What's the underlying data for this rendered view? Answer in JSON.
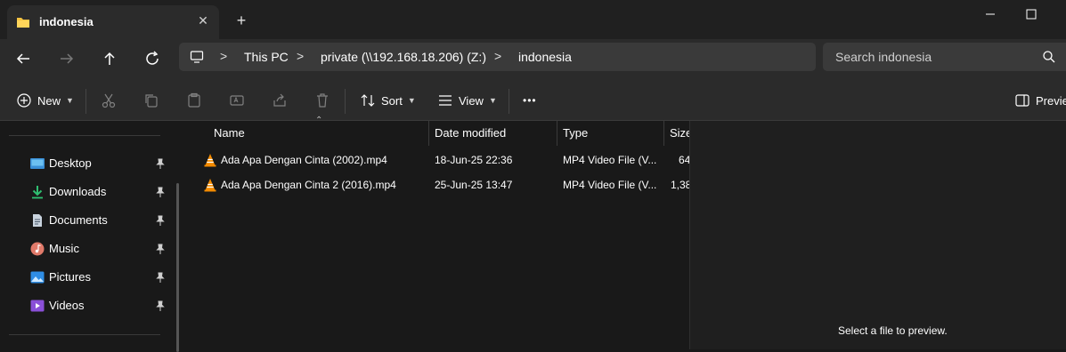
{
  "window": {
    "tab_title": "indonesia",
    "tab_close": "✕",
    "new_tab": "+"
  },
  "address": {
    "crumbs": [
      "This PC",
      "private (\\\\192.168.18.206) (Z:)",
      "indonesia"
    ],
    "separator": ">"
  },
  "search": {
    "placeholder": "Search indonesia"
  },
  "toolbar": {
    "new_label": "New",
    "sort_label": "Sort",
    "view_label": "View",
    "more_label": "•••",
    "preview_label": "Preview"
  },
  "sidebar": {
    "items": [
      {
        "label": "Desktop",
        "icon": "desktop-icon"
      },
      {
        "label": "Downloads",
        "icon": "downloads-icon"
      },
      {
        "label": "Documents",
        "icon": "documents-icon"
      },
      {
        "label": "Music",
        "icon": "music-icon"
      },
      {
        "label": "Pictures",
        "icon": "pictures-icon"
      },
      {
        "label": "Videos",
        "icon": "videos-icon"
      }
    ]
  },
  "files": {
    "columns": [
      "Name",
      "Date modified",
      "Type",
      "Size"
    ],
    "rows": [
      {
        "name": "Ada Apa Dengan Cinta (2002).mp4",
        "date": "18-Jun-25 22:36",
        "type": "MP4 Video File (V...",
        "size": "64"
      },
      {
        "name": "Ada Apa Dengan Cinta 2 (2016).mp4",
        "date": "25-Jun-25 13:47",
        "type": "MP4 Video File (V...",
        "size": "1,38"
      }
    ]
  },
  "preview": {
    "message": "Select a file to preview."
  },
  "colors": {
    "accent": "#60cdff",
    "folder": "#f6c342",
    "vlc": "#f48b00"
  }
}
